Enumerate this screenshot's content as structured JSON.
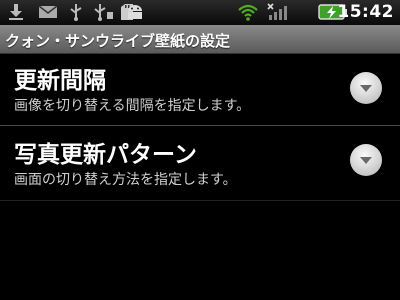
{
  "status_bar": {
    "time": "15:42",
    "icons": [
      "download-icon",
      "mail-icon",
      "usb-icon",
      "usb-debug-icon",
      "sd-card-icon",
      "android-icon",
      "wifi-icon",
      "no-sim-signal-icon",
      "battery-charging-icon"
    ]
  },
  "title_bar": {
    "title": "クォン・サンウライブ壁紙の設定"
  },
  "preferences": [
    {
      "title": "更新間隔",
      "summary": "画像を切り替える間隔を指定します。"
    },
    {
      "title": "写真更新パターン",
      "summary": "画面の切り替え方法を指定します。"
    }
  ]
}
